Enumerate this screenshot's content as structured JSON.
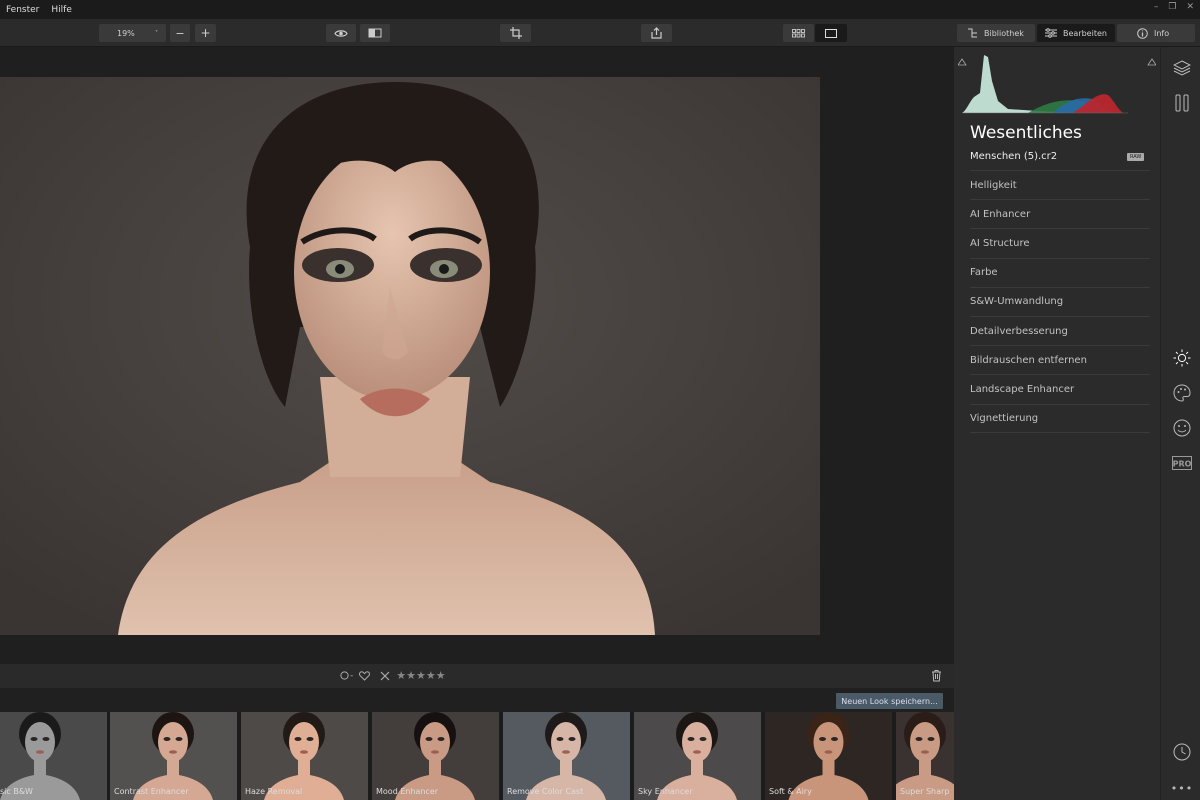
{
  "menu": {
    "items": [
      "Fenster",
      "Hilfe"
    ]
  },
  "toolbar": {
    "zoom_value": "19%",
    "zoom_minus": "−",
    "zoom_plus": "+"
  },
  "right_tabs": {
    "library": "Bibliothek",
    "edit": "Bearbeiten",
    "info": "Info"
  },
  "panel": {
    "title": "Wesentliches",
    "filename": "Menschen (5).cr2",
    "raw_badge": "RAW",
    "items": [
      "Helligkeit",
      "AI Enhancer",
      "AI Structure",
      "Farbe",
      "S&W-Umwandlung",
      "Detailverbesserung",
      "Bildrauschen entfernen",
      "Landscape Enhancer",
      "Vignettierung"
    ]
  },
  "rating": {
    "stars": "★★★★★",
    "label_dash": "-"
  },
  "save_look": "Neuen Look speichern...",
  "looks": [
    "sic B&W",
    "Contrast Enhancer",
    "Haze Removal",
    "Mood Enhancer",
    "Remove Color Cast",
    "Sky Enhancer",
    "Soft & Airy",
    "Super Sharp"
  ],
  "colors": {
    "accent": "#4a5a66",
    "panel_bg": "#2b2b2b",
    "photo_bg": "#474240"
  }
}
